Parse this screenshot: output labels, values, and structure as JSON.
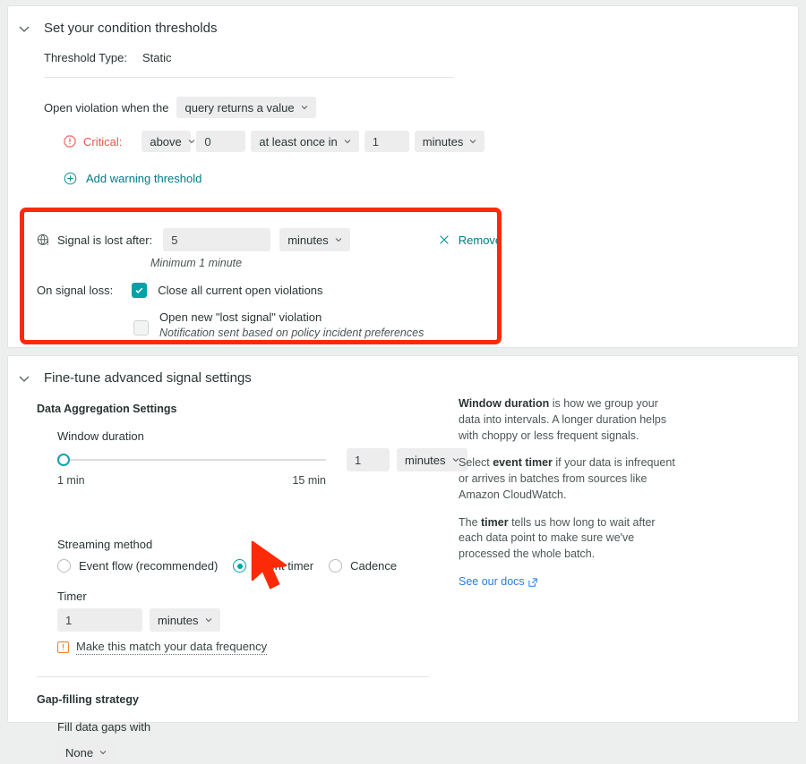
{
  "thresholds": {
    "title": "Set your condition thresholds",
    "chevron_icon": "chevron-down-icon",
    "threshold_type_label": "Threshold Type:",
    "threshold_type_value": "Static",
    "open_violation_label": "Open violation when the",
    "open_violation_select": "query returns a value",
    "critical_icon": "critical-alert-icon",
    "critical_label": "Critical:",
    "operator_select": "above",
    "threshold_value": "0",
    "frequency_select": "at least once in",
    "duration_value": "1",
    "duration_unit_select": "minutes",
    "add_warning_icon": "plus-circle-icon",
    "add_warning_label": "Add warning threshold"
  },
  "signal_loss": {
    "icon": "signal-lost-icon",
    "label": "Signal is lost after:",
    "value": "5",
    "unit_select": "minutes",
    "remove_icon": "close-icon",
    "remove_label": "Remove",
    "minimum_note": "Minimum 1 minute",
    "on_signal_loss_label": "On signal loss:",
    "close_violations_label": "Close all current open violations",
    "close_violations_checked": true,
    "open_lost_signal_label": "Open new \"lost signal\" violation",
    "open_lost_signal_checked": false,
    "open_lost_signal_note": "Notification sent based on policy incident preferences"
  },
  "advanced": {
    "title": "Fine-tune advanced signal settings",
    "chevron_icon": "chevron-down-icon",
    "aggregation_heading": "Data Aggregation Settings",
    "window_duration_label": "Window duration",
    "window_min_label": "1 min",
    "window_max_label": "15 min",
    "window_value": "1",
    "window_unit_select": "minutes",
    "streaming_method_label": "Streaming method",
    "radio_event_flow": "Event flow (recommended)",
    "radio_event_timer": "Event timer",
    "radio_cadence": "Cadence",
    "selected_streaming_method": "Event timer",
    "timer_label": "Timer",
    "timer_value": "1",
    "timer_unit_select": "minutes",
    "warning_icon": "warning-square-icon",
    "warning_link": "Make this match your data frequency",
    "gap_heading": "Gap-filling strategy",
    "fill_label": "Fill data gaps with",
    "fill_select": "None"
  },
  "help": {
    "p1_bold": "Window duration",
    "p1_rest": " is how we group your data into intervals. A longer duration helps with choppy or less frequent signals.",
    "p2_pre": "Select ",
    "p2_bold": "event timer",
    "p2_rest": " if your data is infrequent or arrives in batches from sources like Amazon CloudWatch.",
    "p3_pre": "The ",
    "p3_bold": "timer",
    "p3_rest": " tells us how long to wait after each data point to make sure we've processed the whole batch.",
    "docs_label": "See our docs",
    "docs_icon": "external-link-icon"
  },
  "annotation": {
    "highlight_color": "#fc2a06",
    "cursor_icon": "mouse-cursor-arrow"
  },
  "colors": {
    "accent": "#017c86",
    "teal": "#00a2a8",
    "critical": "#e8554f",
    "link_blue": "#2a7de1",
    "warning": "#e8833a"
  }
}
